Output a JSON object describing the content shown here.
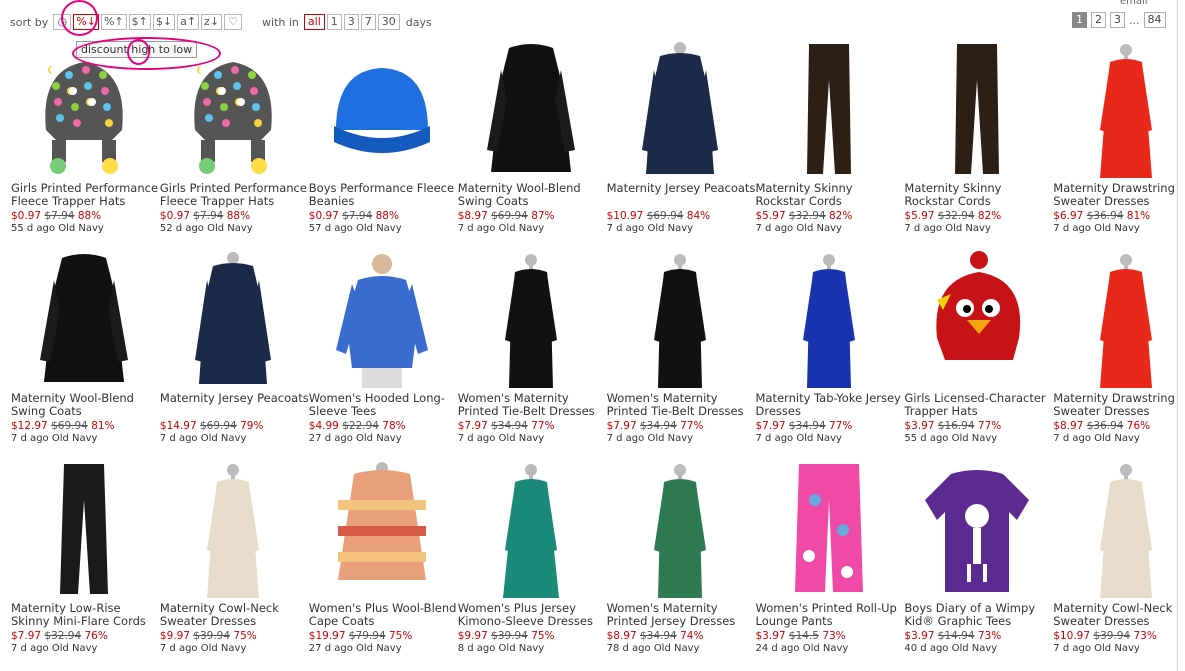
{
  "toolbar": {
    "sort_label": "sort by",
    "sort_buttons": [
      {
        "label": "◷",
        "icon": "clock-icon"
      },
      {
        "label": "%↓"
      },
      {
        "label": "%↑"
      },
      {
        "label": "$↑"
      },
      {
        "label": "$↓"
      },
      {
        "label": "a↑"
      },
      {
        "label": "z↓"
      },
      {
        "label": "♡",
        "icon": "heart-icon"
      }
    ],
    "active_sort": 1,
    "within_label": "with in",
    "day_options": [
      "all",
      "1",
      "3",
      "7",
      "30"
    ],
    "active_day": 0,
    "days_label": "days",
    "top_cut_text": "email"
  },
  "tooltip": {
    "text": "discount high to low"
  },
  "pager": {
    "pages": [
      "1",
      "2",
      "3"
    ],
    "ellipsis": "...",
    "last": "84",
    "current": "1"
  },
  "colors": {
    "accent_red": "#cc0000",
    "annotation_pink": "#e6007e"
  },
  "products": [
    {
      "title": "Girls Printed Performance Fleece Trapper Hats",
      "price": "$0.97",
      "old_price": "$7.94",
      "discount": "88%",
      "age": "55 d ago",
      "store": "Old Navy",
      "img": "dots-hat"
    },
    {
      "title": "Girls Printed Performance Fleece Trapper Hats",
      "price": "$0.97",
      "old_price": "$7.94",
      "discount": "88%",
      "age": "52 d ago",
      "store": "Old Navy",
      "img": "dots-hat"
    },
    {
      "title": "Boys Performance Fleece Beanies",
      "price": "$0.97",
      "old_price": "$7.94",
      "discount": "88%",
      "age": "57 d ago",
      "store": "Old Navy",
      "img": "beanie"
    },
    {
      "title": "Maternity Wool-Blend Swing Coats",
      "price": "$8.97",
      "old_price": "$69.94",
      "discount": "87%",
      "age": "7 d ago",
      "store": "Old Navy",
      "img": "coat"
    },
    {
      "title": "Maternity Jersey Peacoats",
      "price": "$10.97",
      "old_price": "$69.94",
      "discount": "84%",
      "age": "7 d ago",
      "store": "Old Navy",
      "img": "coat-navy"
    },
    {
      "title": "Maternity Skinny Rockstar Cords",
      "price": "$5.97",
      "old_price": "$32.94",
      "discount": "82%",
      "age": "7 d ago",
      "store": "Old Navy",
      "img": "pants-brown"
    },
    {
      "title": "Maternity Skinny Rockstar Cords",
      "price": "$5.97",
      "old_price": "$32.94",
      "discount": "82%",
      "age": "7 d ago",
      "store": "Old Navy",
      "img": "pants-brown"
    },
    {
      "title": "Maternity Drawstring Sweater Dresses",
      "price": "$6.97",
      "old_price": "$36.94",
      "discount": "81%",
      "age": "7 d ago",
      "store": "Old Navy",
      "img": "dress-red"
    },
    {
      "title": "Maternity Wool-Blend Swing Coats",
      "price": "$12.97",
      "old_price": "$69.94",
      "discount": "81%",
      "age": "7 d ago",
      "store": "Old Navy",
      "img": "coat"
    },
    {
      "title": "Maternity Jersey Peacoats",
      "price": "$14.97",
      "old_price": "$69.94",
      "discount": "79%",
      "age": "7 d ago",
      "store": "Old Navy",
      "img": "coat-navy"
    },
    {
      "title": "Women's Hooded Long-Sleeve Tees",
      "price": "$4.99",
      "old_price": "$22.94",
      "discount": "78%",
      "age": "27 d ago",
      "store": "Old Navy",
      "img": "hoodie"
    },
    {
      "title": "Women's Maternity Printed Tie-Belt Dresses",
      "price": "$7.97",
      "old_price": "$34.94",
      "discount": "77%",
      "age": "7 d ago",
      "store": "Old Navy",
      "img": "dress-black"
    },
    {
      "title": "Women's Maternity Printed Tie-Belt Dresses",
      "price": "$7.97",
      "old_price": "$34.94",
      "discount": "77%",
      "age": "7 d ago",
      "store": "Old Navy",
      "img": "dress-black"
    },
    {
      "title": "Maternity Tab-Yoke Jersey Dresses",
      "price": "$7.97",
      "old_price": "$34.94",
      "discount": "77%",
      "age": "7 d ago",
      "store": "Old Navy",
      "img": "dress-blue"
    },
    {
      "title": "Girls Licensed-Character Trapper Hats",
      "price": "$3.97",
      "old_price": "$16.94",
      "discount": "77%",
      "age": "55 d ago",
      "store": "Old Navy",
      "img": "bird-hat"
    },
    {
      "title": "Maternity Drawstring Sweater Dresses",
      "price": "$8.97",
      "old_price": "$36.94",
      "discount": "76%",
      "age": "7 d ago",
      "store": "Old Navy",
      "img": "dress-red"
    },
    {
      "title": "Maternity Low-Rise Skinny Mini-Flare Cords",
      "price": "$7.97",
      "old_price": "$32.94",
      "discount": "76%",
      "age": "7 d ago",
      "store": "Old Navy",
      "img": "pants-black"
    },
    {
      "title": "Maternity Cowl-Neck Sweater Dresses",
      "price": "$9.97",
      "old_price": "$39.94",
      "discount": "75%",
      "age": "7 d ago",
      "store": "Old Navy",
      "img": "dress-cream"
    },
    {
      "title": "Women's Plus Wool-Blend Cape Coats",
      "price": "$19.97",
      "old_price": "$79.94",
      "discount": "75%",
      "age": "27 d ago",
      "store": "Old Navy",
      "img": "cape"
    },
    {
      "title": "Women's Plus Jersey Kimono-Sleeve Dresses",
      "price": "$9.97",
      "old_price": "$39.94",
      "discount": "75%",
      "age": "8 d ago",
      "store": "Old Navy",
      "img": "dress-teal"
    },
    {
      "title": "Women's Maternity Printed Jersey Dresses",
      "price": "$8.97",
      "old_price": "$34.94",
      "discount": "74%",
      "age": "78 d ago",
      "store": "Old Navy",
      "img": "dress-print"
    },
    {
      "title": "Women's Printed Roll-Up Lounge Pants",
      "price": "$3.97",
      "old_price": "$14.5",
      "discount": "73%",
      "age": "24 d ago",
      "store": "Old Navy",
      "img": "pants-pink"
    },
    {
      "title": "Boys Diary of a Wimpy Kid® Graphic Tees",
      "price": "$3.97",
      "old_price": "$14.94",
      "discount": "73%",
      "age": "40 d ago",
      "store": "Old Navy",
      "img": "tee-purple"
    },
    {
      "title": "Maternity Cowl-Neck Sweater Dresses",
      "price": "$10.97",
      "old_price": "$39.94",
      "discount": "73%",
      "age": "7 d ago",
      "store": "Old Navy",
      "img": "dress-cream"
    }
  ]
}
